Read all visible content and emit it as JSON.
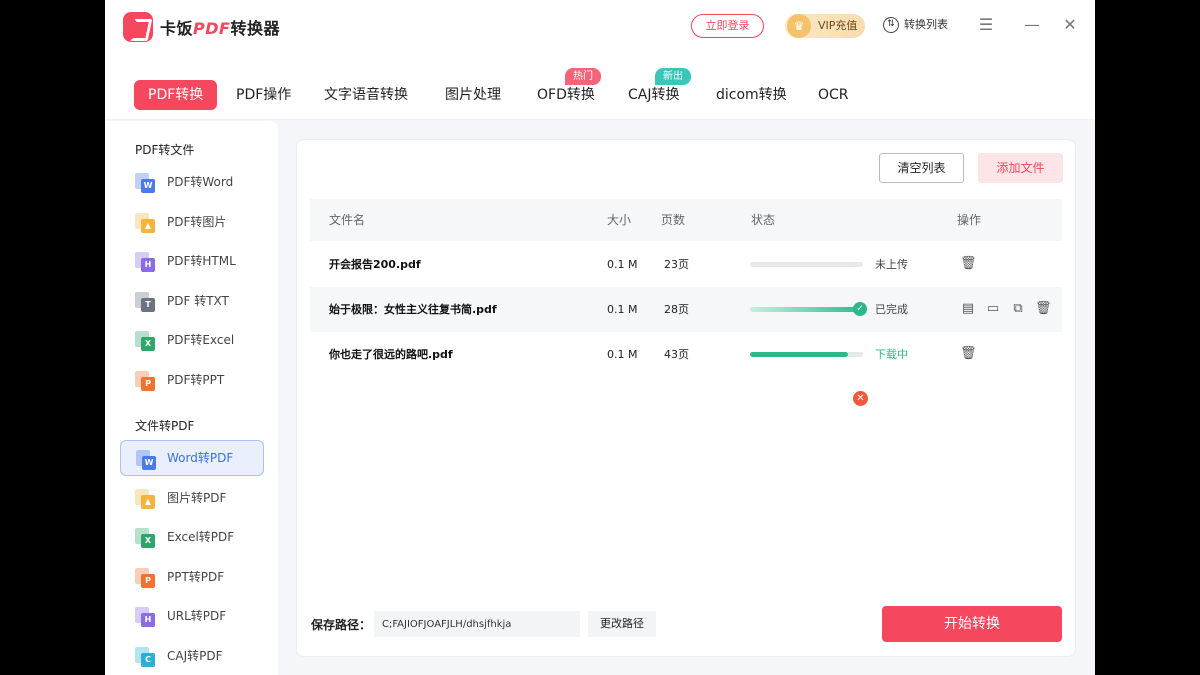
{
  "app": {
    "brand_prefix": "卡饭",
    "brand_pdf": "PDF",
    "brand_suffix": "转换器",
    "login": "立即登录",
    "vip": "VIP充值",
    "conversion_list": "转换列表"
  },
  "tabs": [
    {
      "label": "PDF转换"
    },
    {
      "label": "PDF操作"
    },
    {
      "label": "文字语音转换"
    },
    {
      "label": "图片处理"
    },
    {
      "label": "OFD转换",
      "badge": "热门"
    },
    {
      "label": "CAJ转换",
      "badge": "新出"
    },
    {
      "label": "dicom转换"
    },
    {
      "label": "OCR"
    }
  ],
  "sidebar": {
    "section1": "PDF转文件",
    "items1": [
      {
        "label": "PDF转Word",
        "icon": "word-icon",
        "letter": "W",
        "color": "#4a7be8"
      },
      {
        "label": "PDF转图片",
        "icon": "image-icon",
        "letter": "▲",
        "color": "#f6b53a"
      },
      {
        "label": "PDF转HTML",
        "icon": "html-icon",
        "letter": "H",
        "color": "#8b6ce6"
      },
      {
        "label": "PDF 转TXT",
        "icon": "txt-icon",
        "letter": "T",
        "color": "#6b7280"
      },
      {
        "label": "PDF转Excel",
        "icon": "excel-icon",
        "letter": "X",
        "color": "#2fa56a"
      },
      {
        "label": "PDF转PPT",
        "icon": "ppt-icon",
        "letter": "P",
        "color": "#f2732f"
      }
    ],
    "section2": "文件转PDF",
    "items2": [
      {
        "label": "Word转PDF",
        "icon": "word-icon",
        "letter": "W",
        "color": "#4a7be8"
      },
      {
        "label": "图片转PDF",
        "icon": "image-icon",
        "letter": "▲",
        "color": "#f6b53a"
      },
      {
        "label": "Excel转PDF",
        "icon": "excel-icon",
        "letter": "X",
        "color": "#2fa56a"
      },
      {
        "label": "PPT转PDF",
        "icon": "ppt-icon",
        "letter": "P",
        "color": "#f2732f"
      },
      {
        "label": "URL转PDF",
        "icon": "url-icon",
        "letter": "H",
        "color": "#8b6ce6"
      },
      {
        "label": "CAJ转PDF",
        "icon": "caj-icon",
        "letter": "C",
        "color": "#2ab0d8"
      }
    ]
  },
  "toolbar": {
    "clear": "清空列表",
    "add": "添加文件"
  },
  "table": {
    "headers": {
      "name": "文件名",
      "size": "大小",
      "pages": "页数",
      "status": "状态",
      "actions": "操作"
    },
    "rows": [
      {
        "name": "开会报告200.pdf",
        "size": "0.1 M",
        "pages": "23页",
        "progress": 0,
        "status": "未上传"
      },
      {
        "name": "始于极限：女性主义往复书简.pdf",
        "size": "0.1 M",
        "pages": "28页",
        "progress": 1.0,
        "status": "已完成"
      },
      {
        "name": "你也走了很远的路吧.pdf",
        "size": "0.1 M",
        "pages": "43页",
        "progress": 0.87,
        "status": "下载中"
      }
    ]
  },
  "footer": {
    "save_label": "保存路径：",
    "save_path": "C;FAJIOFJOAFJLH/dhsjfhkja",
    "change_path": "更改路径",
    "start": "开始转换"
  },
  "colors": {
    "accent": "#f5475d",
    "success": "#2bb98c",
    "hot_badge": "#f5657a",
    "new_badge": "#38c7b8"
  }
}
